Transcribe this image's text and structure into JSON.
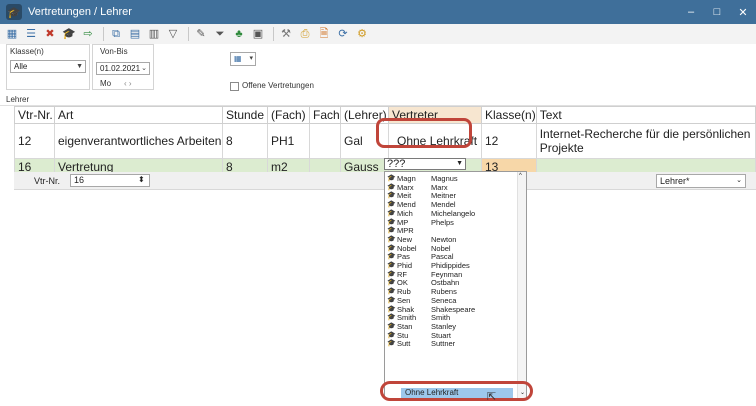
{
  "window": {
    "title": "Vertretungen / Lehrer",
    "minimize": "‒",
    "maximize": "□",
    "close": "✕"
  },
  "filter": {
    "klasse_label": "Klasse(n)",
    "klasse_value": "Alle",
    "vonbis_label": "Von-Bis",
    "date_value": "01.02.2021",
    "weekday": "Mo",
    "weekday_nav": "‹ ›",
    "offene_label": "Offene Vertretungen",
    "lehrer_label": "Lehrer"
  },
  "table": {
    "columns": [
      "Vtr-Nr.",
      "Art",
      "Stunde",
      "(Fach)",
      "Fach",
      "(Lehrer)",
      "Vertreter",
      "Klasse(n)",
      "Text"
    ],
    "rows": [
      {
        "nr": "12",
        "art": "eigenverantwortliches Arbeiten",
        "stunde": "8",
        "fach_alt": "PH1",
        "fach": "",
        "lehrer_alt": "Gal",
        "vertreter": "Ohne Lehrkraft",
        "klasse": "12",
        "text": "Internet-Recherche für die persönlichen Projekte"
      },
      {
        "nr": "16",
        "art": "Vertretung",
        "stunde": "8",
        "fach_alt": "m2",
        "fach": "",
        "lehrer_alt": "Gauss",
        "vertreter": "???",
        "klasse": "13",
        "text": ""
      }
    ]
  },
  "status": {
    "vtr_label": "Vtr-Nr.",
    "vtr_value": "16",
    "lehrer_filter": "Lehrer*"
  },
  "dropdown": {
    "items": [
      {
        "code": "Magn",
        "name": "Magnus"
      },
      {
        "code": "Marx",
        "name": "Marx"
      },
      {
        "code": "Meit",
        "name": "Meitner"
      },
      {
        "code": "Mend",
        "name": "Mendel"
      },
      {
        "code": "Mich",
        "name": "Michelangelo"
      },
      {
        "code": "MP",
        "name": "Phelps"
      },
      {
        "code": "MPR",
        "name": ""
      },
      {
        "code": "New",
        "name": "Newton"
      },
      {
        "code": "Nobel",
        "name": "Nobel"
      },
      {
        "code": "Pas",
        "name": "Pascal"
      },
      {
        "code": "Phid",
        "name": "Phidippides"
      },
      {
        "code": "RF",
        "name": "Feynman"
      },
      {
        "code": "OK",
        "name": "Ostbahn"
      },
      {
        "code": "Rub",
        "name": "Rubens"
      },
      {
        "code": "Sen",
        "name": "Seneca"
      },
      {
        "code": "Shak",
        "name": "Shakespeare"
      },
      {
        "code": "Smith",
        "name": "Smith"
      },
      {
        "code": "Stan",
        "name": "Stanley"
      },
      {
        "code": "Stu",
        "name": "Stuart"
      },
      {
        "code": "Sutt",
        "name": "Suttner"
      }
    ],
    "selected": "Ohne Lehrkraft"
  }
}
